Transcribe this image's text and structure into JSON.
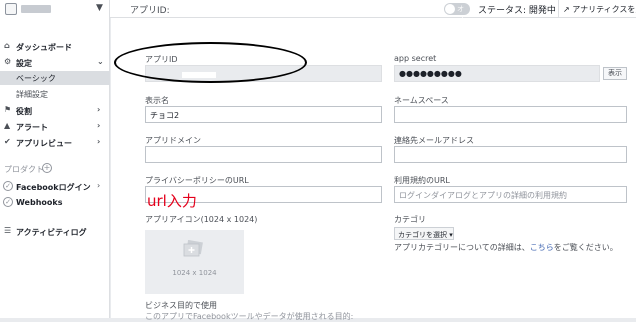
{
  "topbar": {
    "appid_label": "アプリID:",
    "toggle_text": "オフ",
    "status_text": "ステータス: 開発中",
    "analytics_button": "アナリティクスを見る"
  },
  "sidebar": {
    "dashboard": "ダッシュボード",
    "settings": "設定",
    "basic": "ベーシック",
    "advanced": "詳細設定",
    "roles": "役割",
    "alerts": "アラート",
    "app_review": "アプリレビュー",
    "products_header": "プロダクト",
    "facebook_login": "Facebookログイン",
    "webhooks": "Webhooks",
    "activity_log": "アクティビティログ"
  },
  "form": {
    "app_id_label": "アプリID",
    "app_secret_label": "app secret",
    "app_secret_value": "●●●●●●●●●",
    "show_button": "表示",
    "display_name_label": "表示名",
    "display_name_value": "チョコ2",
    "namespace_label": "ネームスペース",
    "app_domain_label": "アプリドメイン",
    "contact_email_label": "連絡先メールアドレス",
    "privacy_label": "プライバシーポリシーのURL",
    "terms_label": "利用規約のURL",
    "terms_placeholder": "ログインダイアログとアプリの詳細の利用規約",
    "app_icon_label": "アプリアイコン(1024 x 1024)",
    "icon_size_text": "1024 x 1024",
    "category_label": "カテゴリ",
    "category_button": "カテゴリを選択 ▾",
    "category_info_pre": "アプリカテゴリーについての詳細は、",
    "category_info_link": "こちら",
    "category_info_post": "をご覧ください。",
    "business_use_label": "ビジネス目的で使用",
    "business_use_sub": "このアプリでFacebookツールやデータが使用される目的:"
  },
  "annotation": {
    "text": "url入力",
    "color": "#e4001b"
  }
}
